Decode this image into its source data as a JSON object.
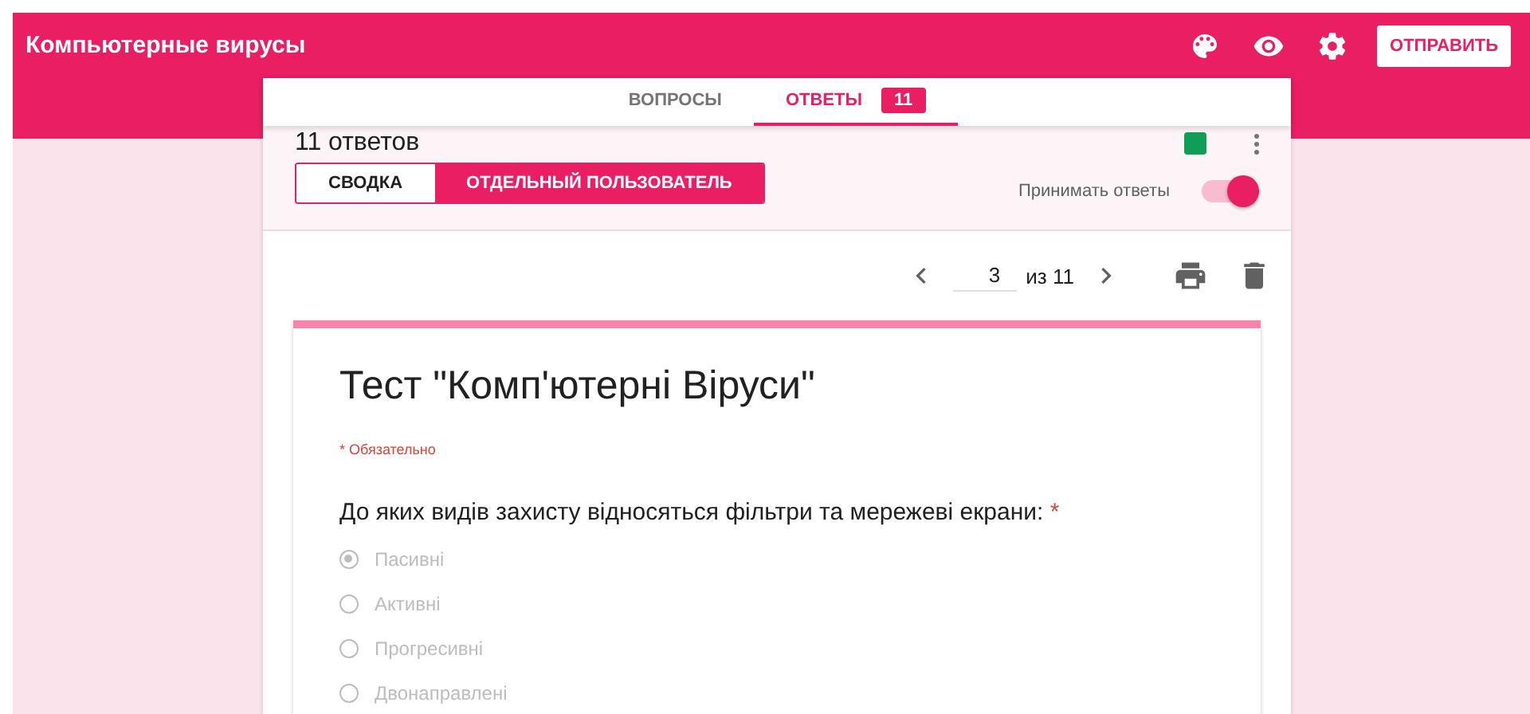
{
  "app": {
    "title": "Компьютерные вирусы",
    "send_button": "ОТПРАВИТЬ"
  },
  "tabs": [
    {
      "label": "ВОПРОСЫ",
      "selected": false
    },
    {
      "label": "ОТВЕТЫ",
      "selected": true,
      "badge": "11"
    }
  ],
  "responses": {
    "count_label": "11 ответов",
    "views": [
      {
        "label": "СВОДКА",
        "selected": false
      },
      {
        "label": "ОТДЕЛЬНЫЙ ПОЛЬЗОВАТЕЛЬ",
        "selected": true
      }
    ],
    "accepting_label": "Принимать ответы",
    "accepting": true,
    "pager": {
      "current": "3",
      "of_label": "из 11"
    }
  },
  "form": {
    "title": "Тест \"Комп'ютерні Віруси\"",
    "required_note": "* Обязательно",
    "questions": [
      {
        "text": "До яких видів захисту відносяться фільтри та мережеві екрани:",
        "required": true,
        "required_mark": "*",
        "options": [
          {
            "label": "Пасивні",
            "selected": true
          },
          {
            "label": "Активні",
            "selected": false
          },
          {
            "label": "Прогресивні",
            "selected": false
          },
          {
            "label": "Двонаправлені",
            "selected": false
          }
        ]
      }
    ]
  }
}
